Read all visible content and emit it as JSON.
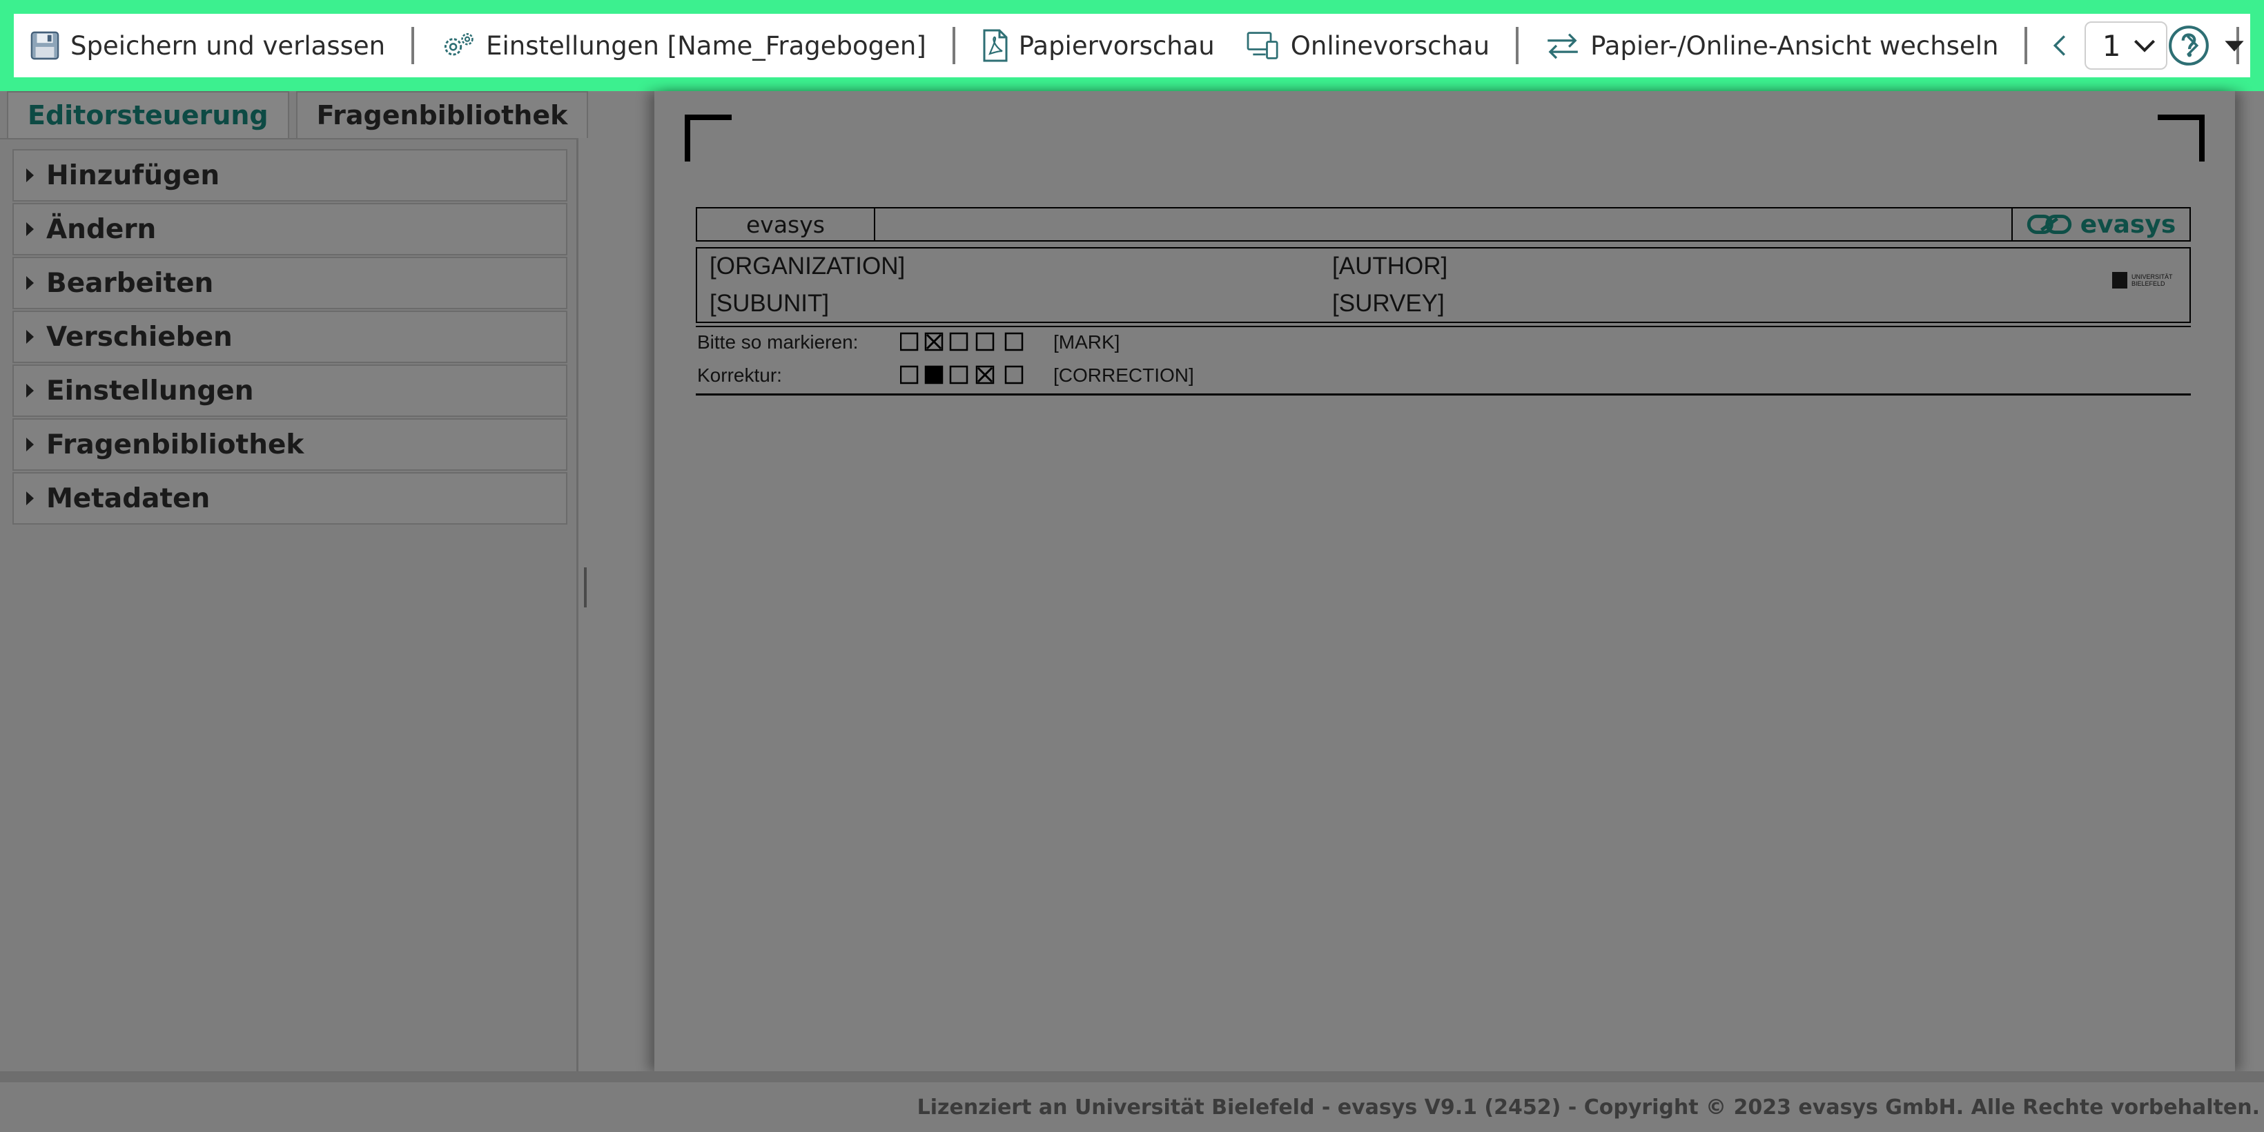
{
  "toolbar": {
    "save_label": "Speichern und verlassen",
    "settings_label": "Einstellungen [Name_Fragebogen]",
    "paper_preview_label": "Papiervorschau",
    "online_preview_label": "Onlinevorschau",
    "switch_view_label": "Papier-/Online-Ansicht wechseln",
    "page_number": "1"
  },
  "colors": {
    "toolbar_accent": "#3cf08f",
    "icon_teal": "#2e6f74",
    "brand_dark_green": "#0e4f47"
  },
  "left_panel": {
    "tabs": [
      {
        "label": "Editorsteuerung",
        "active": true
      },
      {
        "label": "Fragenbibliothek",
        "active": false
      }
    ],
    "sections": [
      {
        "label": "Hinzufügen"
      },
      {
        "label": "Ändern"
      },
      {
        "label": "Bearbeiten"
      },
      {
        "label": "Verschieben"
      },
      {
        "label": "Einstellungen"
      },
      {
        "label": "Fragenbibliothek"
      },
      {
        "label": "Metadaten"
      }
    ]
  },
  "document": {
    "header_left": "evasys",
    "logo_text": "evasys",
    "organization": "[ORGANIZATION]",
    "author": "[AUTHOR]",
    "subunit": "[SUBUNIT]",
    "survey": "[SURVEY]",
    "uni_logo_text": "UNIVERSITÄT BIELEFELD",
    "mark_label": "Bitte so markieren:",
    "mark_value": "[MARK]",
    "correction_label": "Korrektur:",
    "correction_value": "[CORRECTION]"
  },
  "footer": {
    "text": "Lizenziert an Universität Bielefeld - evasys V9.1 (2452) - Copyright © 2023 evasys GmbH. Alle Rechte vorbehalten."
  }
}
